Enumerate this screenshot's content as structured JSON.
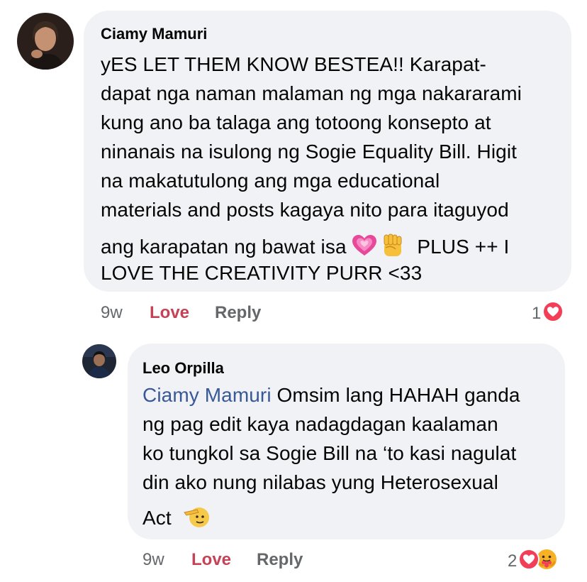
{
  "comments": [
    {
      "author": "Ciamy Mamuri",
      "lines": [
        "yES LET THEM KNOW BESTEA!! Karapat-",
        "dapat nga naman malaman ng mga nakararami",
        "kung ano ba talaga ang totoong konsepto at",
        "ninanais na isulong ng Sogie Equality Bill. Higit",
        "na makatutulong ang mga educational",
        "materials and posts kagaya nito para itaguyod",
        "ang karapatan ng bawat isa",
        "PLUS ++ I",
        "LOVE THE CREATIVITY PURR <33"
      ],
      "emojis": [
        "growing-heart-emoji",
        "raised-fist-emoji"
      ],
      "time": "9w",
      "love_label": "Love",
      "reply_label": "Reply",
      "reaction_count": "1",
      "reactions": [
        "love-reaction-icon"
      ]
    },
    {
      "author": "Leo Orpilla",
      "mention": "Ciamy Mamuri",
      "lines": [
        "Omsim lang HAHAH ganda",
        "ng pag edit kaya nadagdagan kaalaman",
        "ko tungkol sa Sogie Bill na ‘to kasi nagulat",
        "din ako nung nilabas yung Heterosexual",
        "Act"
      ],
      "emojis": [
        "saluting-face-emoji"
      ],
      "time": "9w",
      "love_label": "Love",
      "reply_label": "Reply",
      "reaction_count": "2",
      "reactions": [
        "love-reaction-icon",
        "care-reaction-icon"
      ]
    }
  ]
}
